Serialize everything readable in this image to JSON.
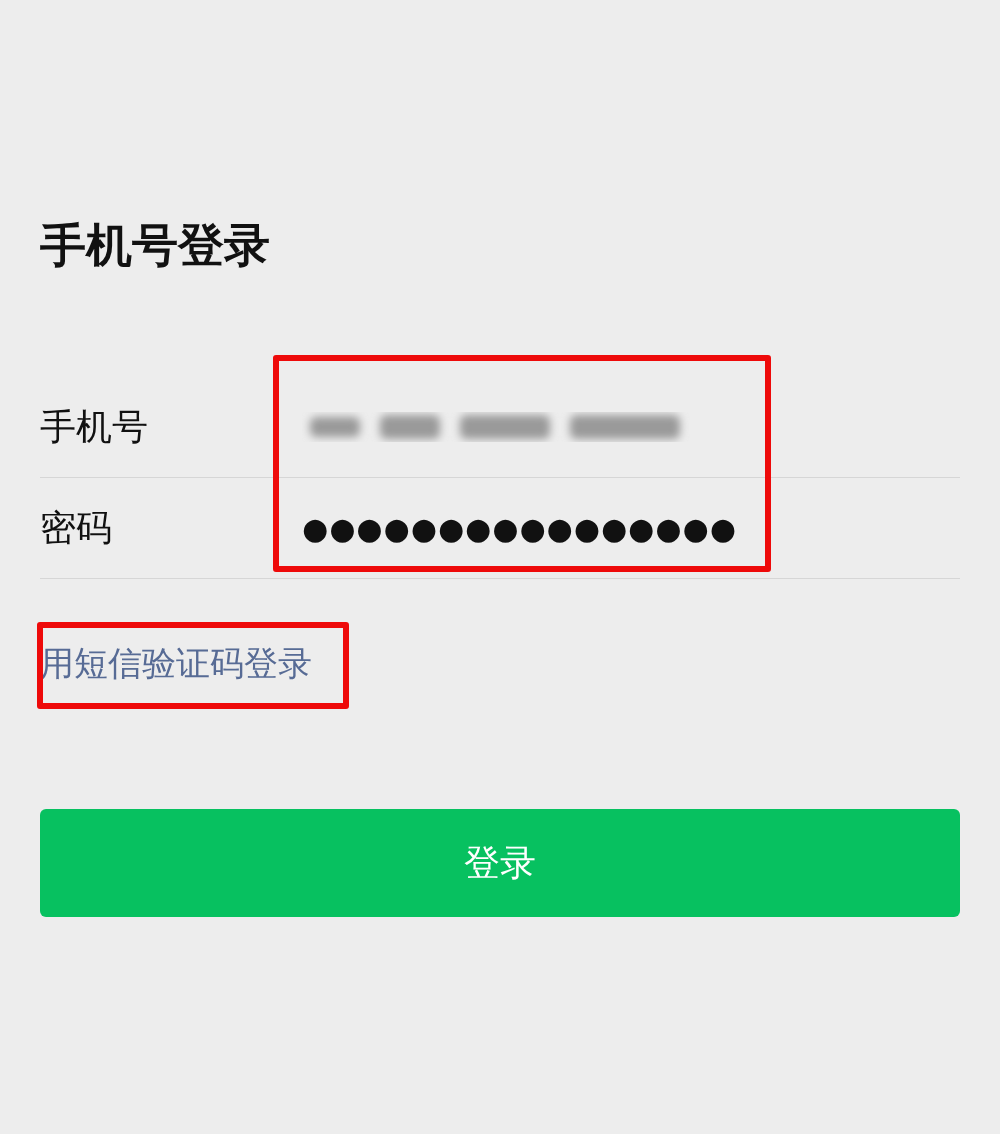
{
  "title": "手机号登录",
  "fields": [
    {
      "kind": "phone",
      "label": "手机号",
      "redacted": true
    },
    {
      "kind": "password",
      "label": "密码",
      "value": "●●●●●●●●●●●●●●●●"
    }
  ],
  "fields_highlighted": true,
  "sms_link": {
    "label": "用短信验证码登录",
    "highlighted": true
  },
  "login_button": {
    "label": "登录"
  }
}
